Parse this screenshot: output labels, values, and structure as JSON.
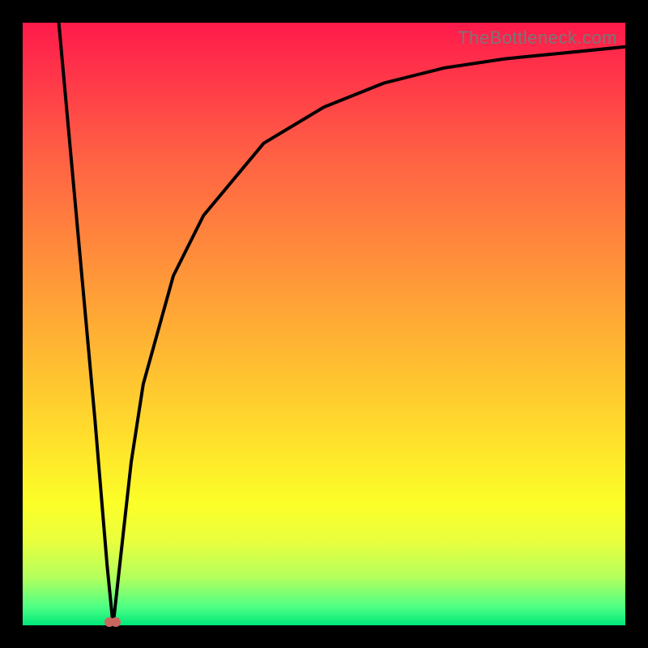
{
  "watermark": "TheBottleneck.com",
  "chart_data": {
    "type": "line",
    "title": "",
    "xlabel": "",
    "ylabel": "",
    "xlim": [
      0,
      100
    ],
    "ylim": [
      0,
      100
    ],
    "grid": false,
    "legend": false,
    "annotations": [
      {
        "kind": "dip-marker",
        "x": 15,
        "y": 0,
        "note": "minimum of curve"
      }
    ],
    "gradient_background": {
      "orientation": "vertical",
      "stops": [
        {
          "pos": 0,
          "meaning": "100 (top)",
          "color": "#ff1a4b"
        },
        {
          "pos": 50,
          "meaning": "50",
          "color": "#ffc030"
        },
        {
          "pos": 80,
          "meaning": "20",
          "color": "#fbff28"
        },
        {
          "pos": 100,
          "meaning": "0 (bottom)",
          "color": "#00e878"
        }
      ]
    },
    "series": [
      {
        "name": "curve",
        "x": [
          6,
          8,
          10,
          12,
          14,
          15,
          16,
          18,
          20,
          25,
          30,
          40,
          50,
          60,
          70,
          80,
          90,
          100
        ],
        "y": [
          100,
          78,
          56,
          34,
          10,
          0,
          9,
          27,
          40,
          58,
          68,
          80,
          86,
          90,
          92.5,
          94,
          95,
          96
        ]
      }
    ]
  }
}
